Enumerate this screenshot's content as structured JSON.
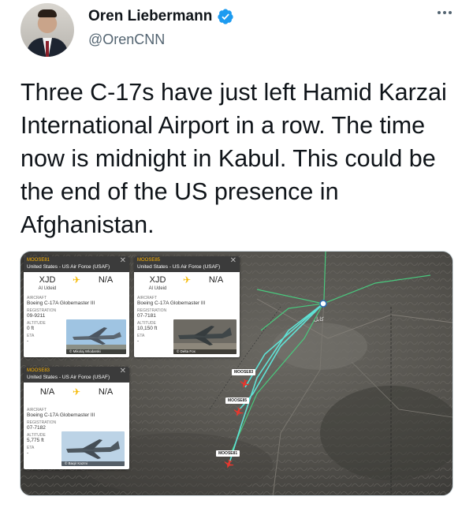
{
  "author": {
    "name": "Oren Liebermann",
    "handle": "@OrenCNN"
  },
  "tweet": {
    "text": "Three C-17s have just left Hamid Karzai International Airport in a row. The time now is midnight in Kabul. This could be the end of the US presence in Afghanistan."
  },
  "flights": [
    {
      "callsign": "MOOSE81",
      "operator": "United States - US Air Force (USAF)",
      "from_code": "XJD",
      "from_name": "Al Udeid",
      "to_code": "N/A",
      "to_name": "",
      "aircraft_label": "AIRCRAFT",
      "aircraft": "Boeing C-17A Globemaster III",
      "registration_label": "REGISTRATION",
      "registration": "09-9211",
      "altitude_label": "ALTITUDE",
      "altitude": "0 ft",
      "eta_label": "ETA",
      "eta": "-",
      "photo_credit": "© Mikolaj Wlodarski"
    },
    {
      "callsign": "MOOSE85",
      "operator": "United States - US Air Force (USAF)",
      "from_code": "XJD",
      "from_name": "Al Udeid",
      "to_code": "N/A",
      "to_name": "",
      "aircraft_label": "AIRCRAFT",
      "aircraft": "Boeing C-17A Globemaster III",
      "registration_label": "REGISTRATION",
      "registration": "07-7181",
      "altitude_label": "ALTITUDE",
      "altitude": "10,150 ft",
      "eta_label": "ETA",
      "eta": "-",
      "photo_credit": "© Delta Fox"
    },
    {
      "callsign": "MOOSE83",
      "operator": "United States - US Air Force (USAF)",
      "from_code": "N/A",
      "from_name": "",
      "to_code": "N/A",
      "to_name": "",
      "aircraft_label": "AIRCRAFT",
      "aircraft": "Boeing C-17A Globemaster III",
      "registration_label": "REGISTRATION",
      "registration": "07-7182",
      "altitude_label": "ALTITUDE",
      "altitude": "5,775 ft",
      "eta_label": "ETA",
      "eta": "-",
      "photo_credit": "© Baqir Kazmi"
    }
  ],
  "map_labels": {
    "moose83": "MOOSE83",
    "moose85": "MOOSE85",
    "moose81": "MOOSE81"
  },
  "icons": {
    "verified": "verified-badge-icon",
    "more": "more-dots-icon",
    "close": "close-icon",
    "plane": "airplane-icon"
  },
  "colors": {
    "verified_blue": "#1d9bf0",
    "track_cyan": "#5fe3d6",
    "map_route_green": "#49c97e",
    "plane_yellow": "#f5b800",
    "callsign_orange": "#ffb400"
  }
}
